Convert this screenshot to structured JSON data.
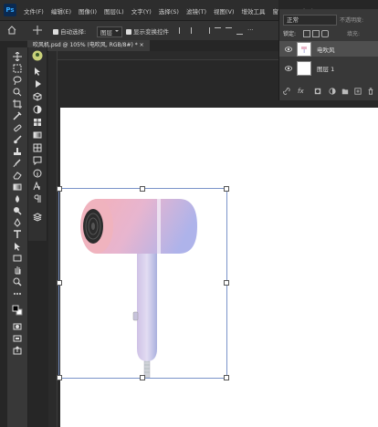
{
  "app": {
    "logo": "Ps"
  },
  "menu": [
    "文件(F)",
    "编辑(E)",
    "图像(I)",
    "图层(L)",
    "文字(Y)",
    "选择(S)",
    "滤镜(T)",
    "视图(V)",
    "增效工具",
    "窗口(W)",
    "帮助(H)"
  ],
  "options": {
    "auto_select_label": "自动选择:",
    "auto_select_value": "图层",
    "transform_label": "显示变换控件"
  },
  "document": {
    "tab_title": "吹风机.psd @ 105% (电吹风, RGB/8#) *"
  },
  "layers_panel": {
    "blend_mode": "正常",
    "opacity_label": "不透明度:",
    "lock_label": "锁定:",
    "fill_label": "填充:",
    "layers": [
      {
        "name": "电吹风",
        "selected": true
      },
      {
        "name": "图层 1",
        "selected": false
      }
    ],
    "footer_fx": "fx"
  },
  "icons": {
    "toolbar": [
      "move-icon",
      "marquee-icon",
      "lasso-icon",
      "quick-select-icon",
      "crop-icon",
      "eyedropper-icon",
      "healing-icon",
      "brush-icon",
      "stamp-icon",
      "history-brush-icon",
      "eraser-icon",
      "gradient-icon",
      "blur-icon",
      "dodge-icon",
      "pen-icon",
      "type-icon",
      "path-select-icon",
      "rectangle-icon",
      "hand-icon",
      "zoom-icon",
      "more-icon",
      "color-swatch-icon",
      "quickmask-icon",
      "screenmode-icon",
      "share-icon"
    ]
  },
  "colors": {
    "accent": "#31a8ff",
    "selection": "#7a93c9",
    "dryer_pink": "#f2aeb9",
    "dryer_lavender": "#b3b8ea"
  }
}
